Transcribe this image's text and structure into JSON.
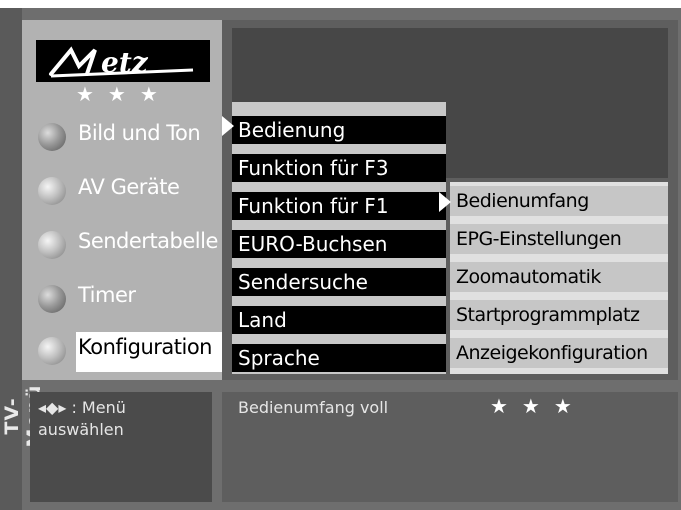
{
  "sidebar": {
    "side_title": "TV-Menü",
    "stars": "★★★",
    "items": [
      {
        "label": "Bild und Ton"
      },
      {
        "label": "AV Geräte"
      },
      {
        "label": "Sendertabelle"
      },
      {
        "label": "Timer"
      },
      {
        "label": "Konfiguration"
      }
    ]
  },
  "menu": {
    "items": [
      {
        "label": "Bedienung"
      },
      {
        "label": "Funktion für F3"
      },
      {
        "label": "Funktion für F1"
      },
      {
        "label": "EURO-Buchsen"
      },
      {
        "label": "Sendersuche"
      },
      {
        "label": "Land"
      },
      {
        "label": "Sprache"
      }
    ]
  },
  "submenu": {
    "items": [
      {
        "label": "Bedienumfang"
      },
      {
        "label": "EPG-Einstellungen"
      },
      {
        "label": "Zoomautomatik"
      },
      {
        "label": "Startprogrammplatz"
      },
      {
        "label": "Anzeigekonfiguration"
      }
    ]
  },
  "hint": {
    "line1": "◂◆▸ : Menü",
    "line2": "auswählen"
  },
  "status": {
    "text": "Bedienumfang voll",
    "stars": "★★★"
  },
  "colors": {
    "frame": "#6e6e6e",
    "panel": "#b2b2b2",
    "highlight": "#ffffff"
  }
}
